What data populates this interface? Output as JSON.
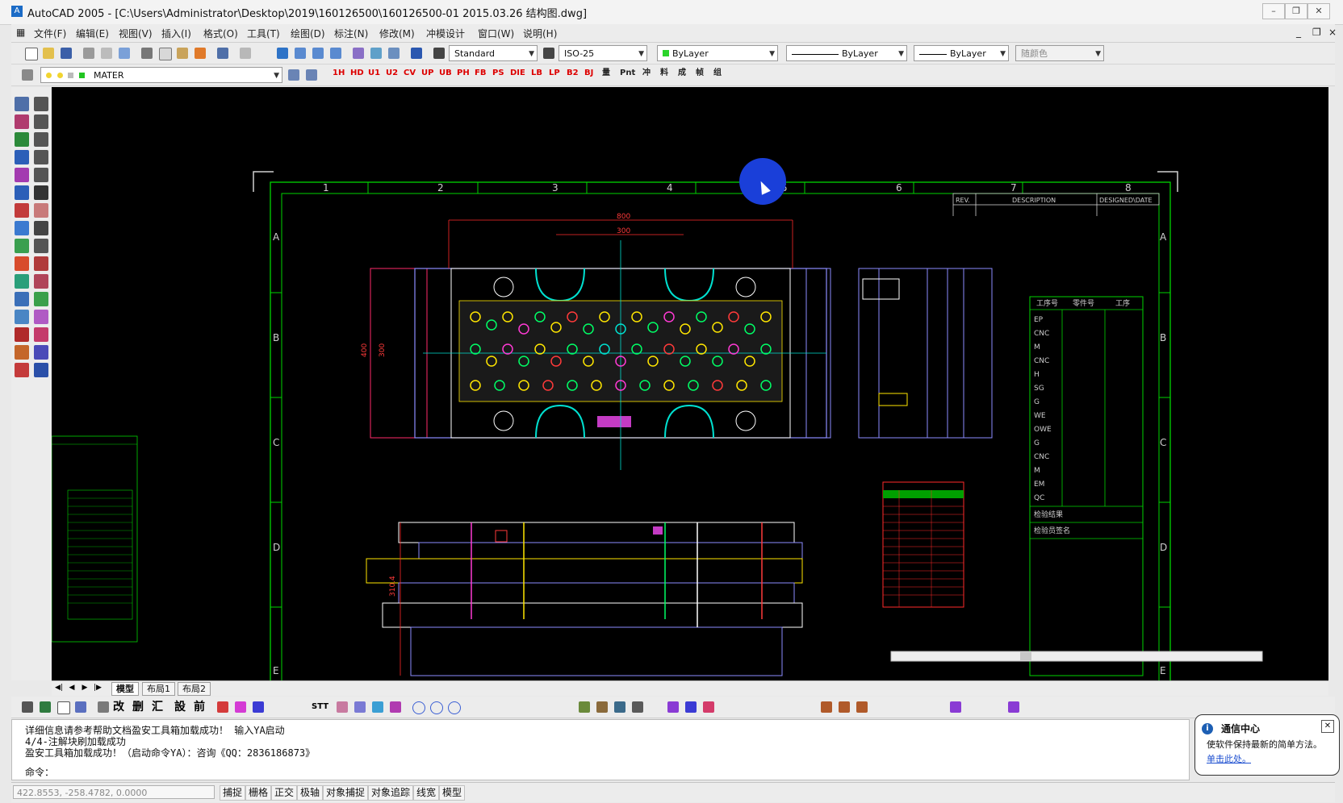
{
  "window": {
    "title": "AutoCAD 2005 - [C:\\Users\\Administrator\\Desktop\\2019\\160126500\\160126500-01 2015.03.26 结构图.dwg]",
    "app_icon": "autocad-icon"
  },
  "menu": [
    "文件(F)",
    "编辑(E)",
    "视图(V)",
    "插入(I)",
    "格式(O)",
    "工具(T)",
    "绘图(D)",
    "标注(N)",
    "修改(M)",
    "冲模设计",
    "窗口(W)",
    "说明(H)"
  ],
  "toolbar": {
    "text_style": "Standard",
    "dim_style": "ISO-25",
    "color": "ByLayer",
    "linetype": "ByLayer",
    "lineweight": "ByLayer",
    "plotstyle": "随颜色",
    "layer": "MATER"
  },
  "plugin_buttons": [
    "1H",
    "HD",
    "U1",
    "U2",
    "CV",
    "UP",
    "UB",
    "PH",
    "FB",
    "PS",
    "DIE",
    "LB",
    "LP",
    "B2",
    "BJ",
    "量",
    "Pnt",
    "冲",
    "料",
    "成",
    "帧",
    "组"
  ],
  "drawing": {
    "column_numbers": [
      "1",
      "2",
      "3",
      "4",
      "5",
      "6",
      "7",
      "8"
    ],
    "row_letters": [
      "A",
      "B",
      "C",
      "D",
      "E"
    ],
    "revision_headers": [
      "REV.",
      "DESCRIPTION",
      "DESIGNED\\DATE"
    ],
    "dims": [
      "800",
      "300",
      "400",
      "300",
      "310.4"
    ],
    "process_table_header": [
      "工序号",
      "零件号",
      "工序"
    ],
    "process_rows": [
      "EP",
      "CNC",
      "M",
      "CNC",
      "H",
      "SG",
      "G",
      "WE",
      "OWE",
      "G",
      "CNC",
      "M",
      "EM",
      "QC"
    ],
    "process_footer": [
      "检验结果",
      "检验员签名"
    ]
  },
  "layout_tabs": [
    "模型",
    "布局1",
    "布局2"
  ],
  "bottom_tools": [
    "改",
    "删",
    "汇",
    "設",
    "前",
    "STT"
  ],
  "command_lines": [
    "详细信息请参考帮助文档盈安工具箱加载成功！ 输入YA启动",
    "4/4-注解块刷加载成功",
    "盈安工具箱加载成功！（启动命令YA）：咨询《QQ：2836186873》"
  ],
  "command_prompt": "命令：",
  "status": {
    "coords": "422.8553, -258.4782, 0.0000",
    "buttons": [
      "捕捉",
      "栅格",
      "正交",
      "极轴",
      "对象捕捉",
      "对象追踪",
      "线宽",
      "模型"
    ]
  },
  "balloon": {
    "title": "通信中心",
    "body": "使软件保持最新的简单方法。",
    "link": "单击此处。"
  }
}
